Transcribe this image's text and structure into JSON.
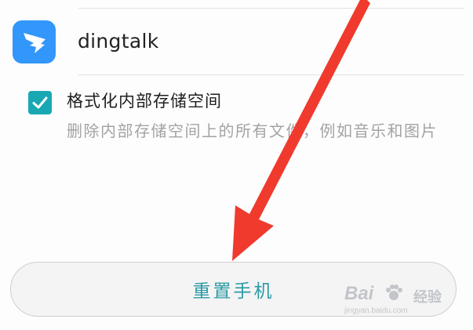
{
  "app": {
    "name": "dingtalk",
    "icon": "dingtalk-logo-icon",
    "icon_color": "#3296fa"
  },
  "option": {
    "checked": true,
    "title": "格式化内部存储空间",
    "description": "删除内部存储空间上的所有文件，例如音乐和图片",
    "checkbox_color": "#1aa7b4"
  },
  "reset_button": {
    "label": "重置手机",
    "label_color": "#2a9aa6"
  },
  "annotation": {
    "arrow_color": "#f03a2e",
    "arrow_icon": "red-arrow-icon"
  },
  "watermark": {
    "brand": "Bai 经验",
    "brand_main": "Bai",
    "brand_sub": "经验",
    "url": "jingyan.baidu.com"
  }
}
